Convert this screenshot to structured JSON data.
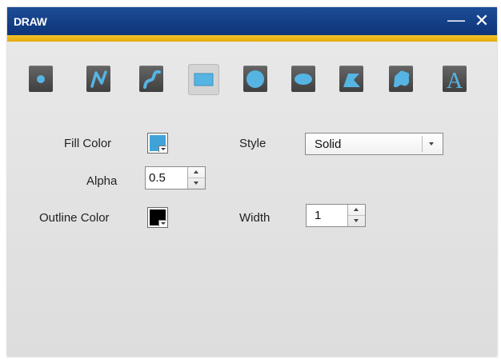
{
  "window": {
    "title": "DRAW",
    "minimize_glyph": "—",
    "close_glyph": "✕"
  },
  "colors": {
    "title_bar": "#1d4d96",
    "accent_bar": "#f2c128",
    "tool_bg": "#555555",
    "tool_shape": "#56b4e3",
    "fill_color": "#3fa3d9",
    "outline_color": "#000000"
  },
  "toolbar": {
    "tools": [
      {
        "name": "point-icon",
        "active": false
      },
      {
        "name": "polyline-icon",
        "active": false
      },
      {
        "name": "freehand-line-icon",
        "active": false
      },
      {
        "name": "rectangle-icon",
        "active": true
      },
      {
        "name": "circle-icon",
        "active": false
      },
      {
        "name": "ellipse-icon",
        "active": false
      },
      {
        "name": "polygon-icon",
        "active": false
      },
      {
        "name": "freehand-polygon-icon",
        "active": false
      },
      {
        "name": "text-icon",
        "active": false,
        "glyph": "A"
      }
    ]
  },
  "form": {
    "fill_color_label": "Fill Color",
    "style_label": "Style",
    "style_value": "Solid",
    "alpha_label": "Alpha",
    "alpha_value": "0.5",
    "outline_color_label": "Outline Color",
    "width_label": "Width",
    "width_value": "1"
  }
}
